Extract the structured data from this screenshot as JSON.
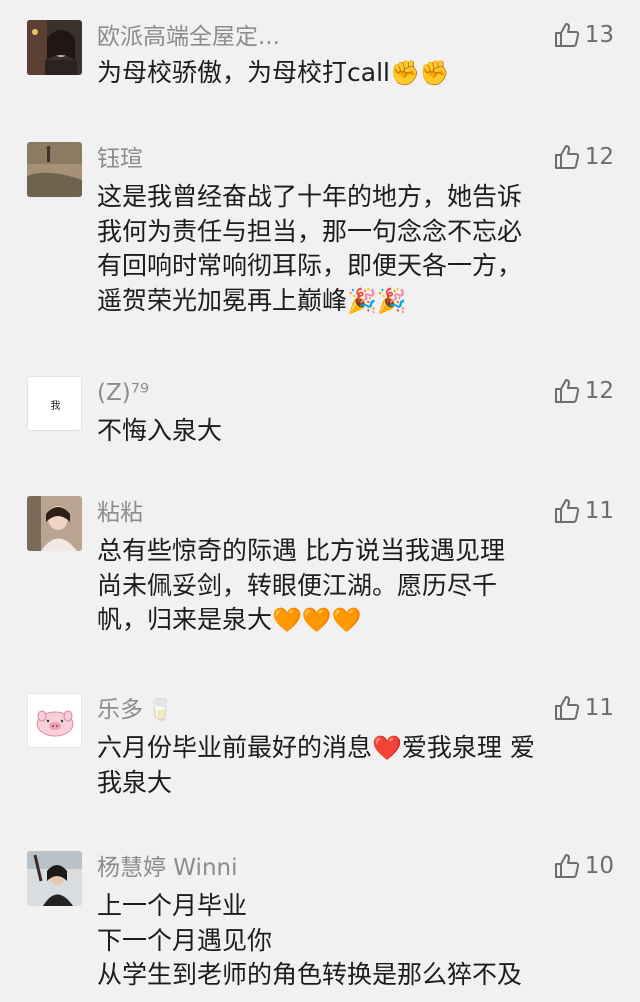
{
  "colors": {
    "background": "#f1f1f1",
    "name_text": "#8c8c8c",
    "body_text": "#1c1c1c",
    "like_icon": "#6d6d6d",
    "emoji_orange": "#ff7a18",
    "emoji_red": "#e01b1b"
  },
  "comments": [
    {
      "avatar": "photo-avatar",
      "name": "欧派高端全屋定...",
      "likes": "13",
      "lines": [
        "为母校骄傲，为母校打call"
      ],
      "line_emojis": [
        "✊✊"
      ]
    },
    {
      "avatar": "photo-avatar",
      "name": "钰瑄",
      "likes": "12",
      "lines": [
        "这是我曾经奋战了十年的地方，她告诉",
        "我何为责任与担当，那一句念念不忘必",
        "有回响时常响彻耳际，即便天各一方，",
        "遥贺荣光加冕再上巅峰"
      ],
      "last_line_emojis": "🎉🎉"
    },
    {
      "avatar": "calligraphy-avatar",
      "avatar_text": "我",
      "name": "(Z)⁷⁹",
      "likes": "12",
      "lines": [
        "不悔入泉大"
      ]
    },
    {
      "avatar": "photo-avatar",
      "name": "粘粘",
      "likes": "11",
      "lines": [
        "总有些惊奇的际遇 比方说当我遇见理",
        "尚未佩妥剑，转眼便江湖。愿历尽千",
        "帆，归来是泉大"
      ],
      "last_line_emojis": "🧡🧡🧡"
    },
    {
      "avatar": "pig-avatar",
      "name": "乐多",
      "name_emoji": "🥛",
      "likes": "11",
      "lines_a": "六月份毕业前最好的消息",
      "heart": "❤️",
      "lines_b": "爱我泉理 爱",
      "lines": [
        "我泉大"
      ]
    },
    {
      "avatar": "photo-avatar",
      "name": "杨慧婷 Winni",
      "likes": "10",
      "lines": [
        "上一个月毕业",
        "下一个月遇见你",
        "从学生到老师的角色转换是那么猝不及"
      ]
    }
  ]
}
